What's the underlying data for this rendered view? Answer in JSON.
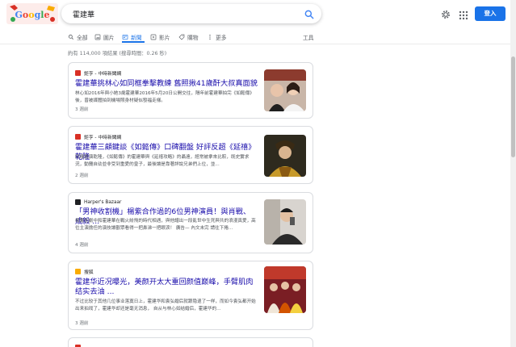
{
  "logo": {
    "alt": "Google"
  },
  "search": {
    "value": "霍建華"
  },
  "header": {
    "signin_label": "登入"
  },
  "tabs": [
    {
      "label": "全部",
      "icon": "search-icon"
    },
    {
      "label": "圖片",
      "icon": "image-icon"
    },
    {
      "label": "新聞",
      "icon": "news-icon",
      "active": true
    },
    {
      "label": "影片",
      "icon": "video-icon"
    },
    {
      "label": "購物",
      "icon": "tag-icon"
    },
    {
      "label": "更多",
      "icon": "more-icon"
    }
  ],
  "tools_label": "工具",
  "result_stats": "約有 114,000 項結果 (搜尋時間：0.26 秒)",
  "results": [
    {
      "source": "鉅亨 - 中時新聞網",
      "title": "霍建華挑林心如同框拳擊教練 舊照揪41歲酐大叔真面貌",
      "snippet": "林心如2016年與小她3歲霍建華2016年5月20日公開交往，隔年前霍建華拍完《如懿傳》後，曾被媒體拍到機場照身材疑似發福走樣。",
      "date": "3 週前"
    },
    {
      "source": "鉅亨 - 中時新聞網",
      "title": "霍建華三顧鍵談《如懿傳》口碑翻盤 好評反超《延禧》乾隆",
      "snippet": "同樣藝演乾隆，《如懿傳》的霍建華與《延禧攻略》的聶遠，經常被拿來比較，既史實求況，動攤自幼並非受到重愛的皇子，最後讓是靠著詳說兄弟們上位，並...",
      "date": "2 週前"
    },
    {
      "source": "Harper's Bazaar",
      "title": "「男神收割機」楊紫合作過的6位男神演員！與肖戰、成毅 ...",
      "snippet": "楊紫在劇中和霍建華在戰火紛飛的時代相遇，與他譜出一段亂世中生死與共的浪漫真愛，高位主演擔任的演技讓觀眾看得一把鼻涕一把眼淚！ 廣告— 內文未完 請往下捲...",
      "date": "4 週前"
    },
    {
      "source": "搜狐",
      "title": "霍建华近况曝光，美颜开太大重回颜值巅峰，手臂肌肉结实去油 ...",
      "snippet": "不过比较于其他几位事业落寞日上，霍建华和袁弘婚后就跟隐退了一样，而如今袁弘都开始出来拍戏了，霍建华却还是毫无消息， 自从与林心如结婚后，霍建华的...",
      "date": "3 週前"
    }
  ],
  "colors": {
    "link": "#1a0dab",
    "accent": "#1a73e8"
  }
}
